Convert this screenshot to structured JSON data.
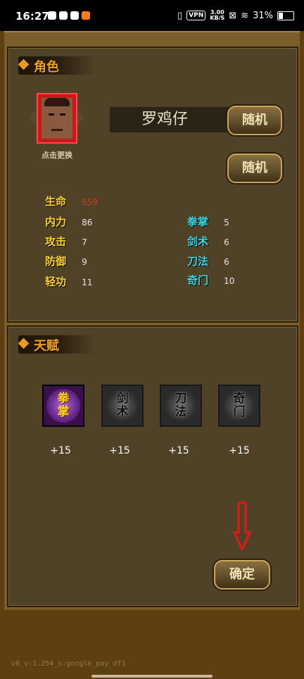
{
  "status_bar": {
    "time": "16:27",
    "vpn": "VPN",
    "speed_value": "3.00",
    "speed_unit": "KB/S",
    "battery": "31%"
  },
  "role_section": {
    "title": "角色",
    "avatar_caption": "点击更换",
    "name": "罗鸡仔",
    "random_button_1": "随机",
    "random_button_2": "随机",
    "stats_left": [
      {
        "label": "生命",
        "value": "559"
      },
      {
        "label": "内力",
        "value": "86"
      },
      {
        "label": "攻击",
        "value": "7"
      },
      {
        "label": "防御",
        "value": "9"
      },
      {
        "label": "轻功",
        "value": "11"
      }
    ],
    "stats_right": [
      {
        "label": "拳掌",
        "value": "5"
      },
      {
        "label": "剑术",
        "value": "6"
      },
      {
        "label": "刀法",
        "value": "6"
      },
      {
        "label": "奇门",
        "value": "10"
      }
    ]
  },
  "talent_section": {
    "title": "天赋",
    "items": [
      {
        "name": "拳掌",
        "value": "+15",
        "selected": true
      },
      {
        "name": "剑术",
        "value": "+15",
        "selected": false
      },
      {
        "name": "刀法",
        "value": "+15",
        "selected": false
      },
      {
        "name": "奇门",
        "value": "+15",
        "selected": false
      }
    ]
  },
  "confirm_button": "确定",
  "footer": "v0_v:1.254_s:google_pay_df1",
  "colors": {
    "accent": "#f0a21e",
    "stat_yellow": "#ffd52a",
    "stat_cyan": "#3ad7e0",
    "arrow_red": "#e01818"
  }
}
